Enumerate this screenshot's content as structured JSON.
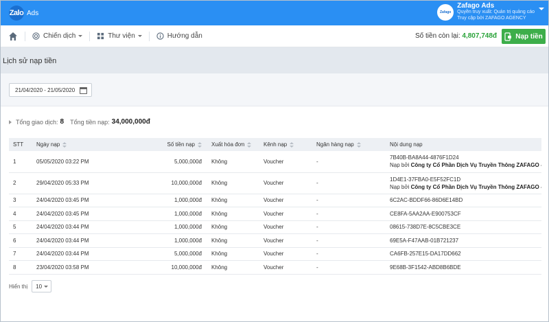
{
  "header": {
    "logo_text": "Zalo",
    "logo_suffix": "Ads",
    "account_name": "Zafago Ads",
    "account_role": "Quyền truy xuất: Quản trị quảng cáo",
    "account_via": "Truy cập bởi ZAFAGO AGENCY",
    "avatar_text": "Zafago"
  },
  "nav": {
    "campaign": "Chiến dịch",
    "library": "Thư viện",
    "guide": "Hướng dẫn",
    "balance_label": "Số tiền còn lại:",
    "balance_value": "4,807,748đ",
    "topup_button": "Nạp tiền"
  },
  "page": {
    "title": "Lịch sử nạp tiền",
    "date_range": "21/04/2020 - 21/05/2020"
  },
  "summary": {
    "transactions_label": "Tổng giao dịch:",
    "transactions_value": "8",
    "total_label": "Tổng tiền nạp:",
    "total_value": "34,000,000đ"
  },
  "table": {
    "columns": [
      "STT",
      "Ngày nạp",
      "Số tiền nạp",
      "Xuất hóa đơn",
      "Kênh nạp",
      "Ngân hàng nạp",
      "Nội dung nạp"
    ],
    "rows": [
      {
        "stt": "1",
        "date": "05/05/2020 03:22 PM",
        "amount": "5,000,000đ",
        "invoice": "Không",
        "channel": "Voucher",
        "bank": "-",
        "content": "7B40B-BA8A44-4876F1D24",
        "by_prefix": "Nạp bởi",
        "by": "Công ty Cổ Phần Dịch Vụ Truyền Thông ZAFAGO - ZAFAGO AGENCY"
      },
      {
        "stt": "2",
        "date": "29/04/2020 05:33 PM",
        "amount": "10,000,000đ",
        "invoice": "Không",
        "channel": "Voucher",
        "bank": "-",
        "content": "1D4E1-37FBA0-E5F52FC1D",
        "by_prefix": "Nạp bởi",
        "by": "Công ty Cổ Phần Dịch Vụ Truyền Thông ZAFAGO - ZAFAGO AGENCY"
      },
      {
        "stt": "3",
        "date": "24/04/2020 03:45 PM",
        "amount": "1,000,000đ",
        "invoice": "Không",
        "channel": "Voucher",
        "bank": "-",
        "content": "6C2AC-BDDF66-86D6E14BD"
      },
      {
        "stt": "4",
        "date": "24/04/2020 03:45 PM",
        "amount": "1,000,000đ",
        "invoice": "Không",
        "channel": "Voucher",
        "bank": "-",
        "content": "CE8FA-5AA2AA-E900753CF"
      },
      {
        "stt": "5",
        "date": "24/04/2020 03:44 PM",
        "amount": "1,000,000đ",
        "invoice": "Không",
        "channel": "Voucher",
        "bank": "-",
        "content": "08615-738D7E-8C5CBE3CE"
      },
      {
        "stt": "6",
        "date": "24/04/2020 03:44 PM",
        "amount": "1,000,000đ",
        "invoice": "Không",
        "channel": "Voucher",
        "bank": "-",
        "content": "69E5A-F47AAB-01B721237"
      },
      {
        "stt": "7",
        "date": "24/04/2020 03:44 PM",
        "amount": "5,000,000đ",
        "invoice": "Không",
        "channel": "Voucher",
        "bank": "-",
        "content": "CA6FB-257E15-DA17DD662"
      },
      {
        "stt": "8",
        "date": "23/04/2020 03:58 PM",
        "amount": "10,000,000đ",
        "invoice": "Không",
        "channel": "Voucher",
        "bank": "-",
        "content": "9E68B-3F1542-ABD8B6BDE"
      }
    ]
  },
  "pager": {
    "label": "Hiển thị",
    "page_size": "10"
  },
  "colors": {
    "header_blue": "#2a8ff3",
    "topup_green": "#3dae4a",
    "balance_green": "#2aa339"
  },
  "icons": [
    "home-icon",
    "target-icon",
    "grid-icon",
    "info-icon",
    "wallet-icon",
    "calendar-icon"
  ]
}
